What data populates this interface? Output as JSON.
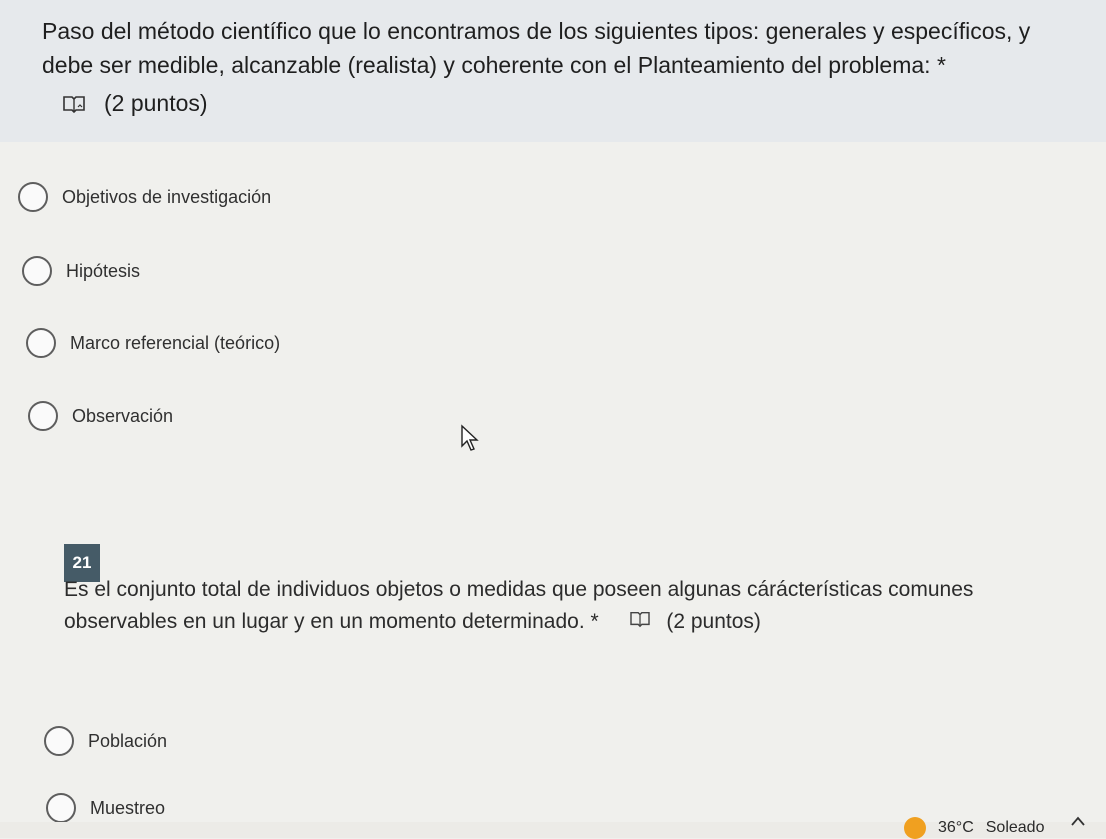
{
  "question_20": {
    "text": "Paso del método científico que lo encontramos de los siguientes tipos: generales y específicos, y debe ser medible, alcanzable (realista) y coherente con el Planteamiento del problema: *",
    "points": "(2 puntos)",
    "reader_icon": "immersive-reader-icon",
    "options": [
      {
        "label": "Objetivos de investigación"
      },
      {
        "label": "Hipótesis"
      },
      {
        "label": "Marco referencial (teórico)"
      },
      {
        "label": "Observación"
      }
    ]
  },
  "question_21": {
    "number": "21",
    "text": "Es el conjunto total de individuos objetos o medidas que poseen algunas cárácterísticas comunes observables en un lugar y en un momento determinado. *",
    "points": "(2 puntos)",
    "reader_icon": "immersive-reader-icon",
    "options": [
      {
        "label": "Población"
      },
      {
        "label": "Muestreo"
      }
    ]
  },
  "taskbar": {
    "temperature": "36°C",
    "weather": "Soleado",
    "weather_icon": "sun-icon",
    "tray_icon": "chevron-up-icon"
  },
  "colors": {
    "header_bg": "#e6e9ec",
    "page_bg": "#f0f0ed",
    "question_number_bg": "#455b67"
  }
}
